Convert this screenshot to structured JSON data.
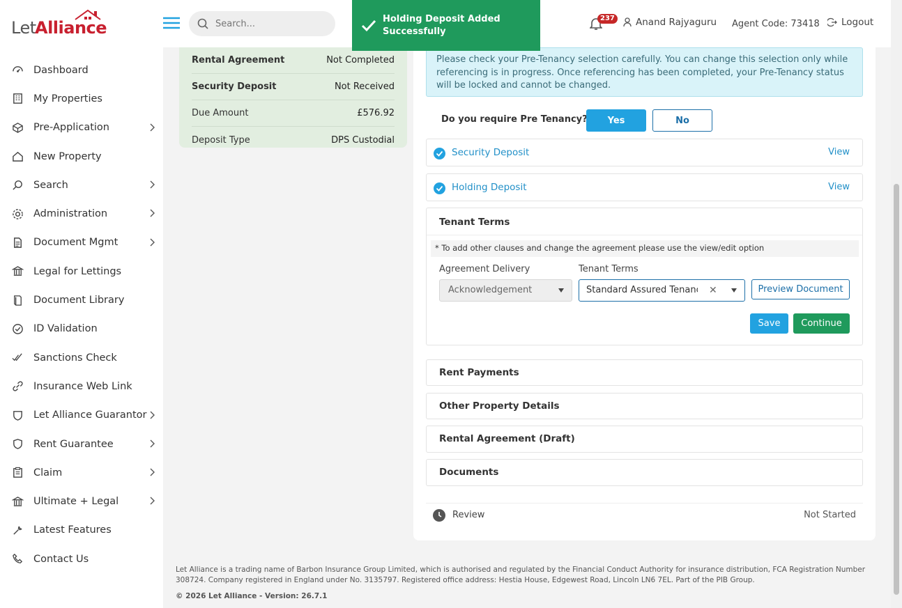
{
  "brand": {
    "let": "Let",
    "alliance": "Alliance"
  },
  "sidebar": {
    "items": [
      {
        "label": "Dashboard",
        "icon": "dashboard-icon",
        "chevron": false
      },
      {
        "label": "My Properties",
        "icon": "building-icon",
        "chevron": false
      },
      {
        "label": "Pre-Application",
        "icon": "box-icon",
        "chevron": true
      },
      {
        "label": "New Property",
        "icon": "home-icon",
        "chevron": false
      },
      {
        "label": "Search",
        "icon": "search-icon",
        "chevron": true
      },
      {
        "label": "Administration",
        "icon": "gear-icon",
        "chevron": true
      },
      {
        "label": "Document Mgmt",
        "icon": "document-icon",
        "chevron": true
      },
      {
        "label": "Legal for Lettings",
        "icon": "bank-icon",
        "chevron": false
      },
      {
        "label": "Document Library",
        "icon": "book-icon",
        "chevron": false
      },
      {
        "label": "ID Validation",
        "icon": "check-circle-icon",
        "chevron": false
      },
      {
        "label": "Sanctions Check",
        "icon": "double-check-icon",
        "chevron": false
      },
      {
        "label": "Insurance Web Link",
        "icon": "link-icon",
        "chevron": false
      },
      {
        "label": "Let Alliance Guarantor",
        "icon": "shield-icon",
        "chevron": true
      },
      {
        "label": "Rent Guarantee",
        "icon": "shield-outline-icon",
        "chevron": true
      },
      {
        "label": "Claim",
        "icon": "clipboard-icon",
        "chevron": true
      },
      {
        "label": "Ultimate + Legal",
        "icon": "bank-icon",
        "chevron": true
      },
      {
        "label": "Latest Features",
        "icon": "wrench-icon",
        "chevron": false
      },
      {
        "label": "Contact Us",
        "icon": "phone-icon",
        "chevron": false
      }
    ]
  },
  "header": {
    "search_placeholder": "Search...",
    "notifications": "237",
    "user": "Anand Rajyaguru",
    "agent_code": "Agent Code: 73418",
    "logout": "Logout"
  },
  "toast": {
    "message": "Holding Deposit Added Successfully"
  },
  "summary": {
    "rows": [
      {
        "k": "Rental Agreement",
        "v": "Not Completed",
        "bold": true
      },
      {
        "k": "Security Deposit",
        "v": "Not Received",
        "bold": true
      },
      {
        "k": "Due Amount",
        "v": "£576.92",
        "bold": false
      },
      {
        "k": "Deposit Type",
        "v": "DPS Custodial",
        "bold": false
      }
    ]
  },
  "main": {
    "info": "Please check your Pre-Tenancy selection carefully. You can change this selection only while referencing is in progress. Once referencing has been completed, your Pre-Tenancy status will be locked and cannot be changed.",
    "pre_tenancy_q": "Do you require Pre Tenancy?",
    "yes": "Yes",
    "no": "No",
    "security_deposit": "Security Deposit",
    "holding_deposit": "Holding Deposit",
    "view": "View",
    "tenant_terms_title": "Tenant Terms",
    "note": "* To add other clauses and change the agreement please use the view/edit option",
    "agreement_delivery_label": "Agreement Delivery",
    "agreement_delivery_value": "Acknowledgement",
    "tenant_terms_label": "Tenant Terms",
    "tenant_terms_value": "Standard Assured Tenancy",
    "preview": "Preview Document",
    "save": "Save",
    "continue": "Continue",
    "rent_payments": "Rent Payments",
    "other_details": "Other Property Details",
    "rental_agreement": "Rental Agreement (Draft)",
    "documents": "Documents",
    "review": "Review",
    "review_status": "Not Started"
  },
  "footer": {
    "text": "Let Alliance is a trading name of Barbon Insurance Group Limited, which is authorised and regulated by the Financial Conduct Authority for insurance distribution, FCA Registration Number 308724. Company registered in England under No. 3135797. Registered office address: Hestia House, Edgewest Road, Lincoln LN6 7EL. Part of the PIB Group.",
    "version": "© 2026 Let Alliance - Version: 26.7.1"
  },
  "colors": {
    "primary": "#22a2e0",
    "success": "#1f9a5c",
    "brand_red": "#c8202f"
  }
}
